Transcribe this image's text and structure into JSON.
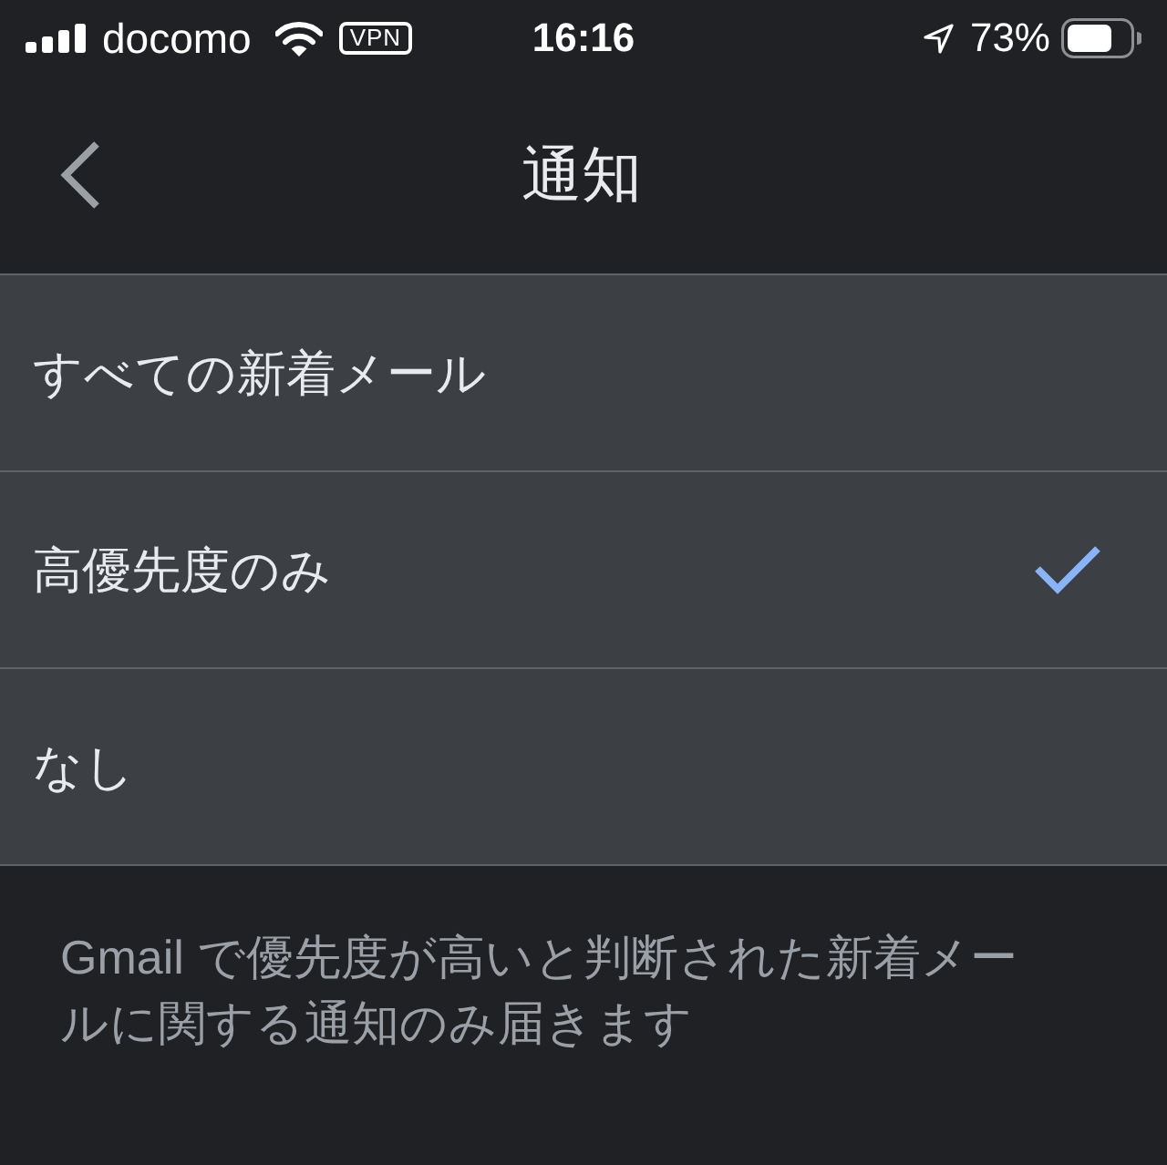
{
  "status_bar": {
    "carrier": "docomo",
    "vpn": "VPN",
    "time": "16:16",
    "battery": "73%"
  },
  "nav_bar": {
    "title": "通知"
  },
  "options": [
    {
      "label": "すべての新着メール",
      "selected": false
    },
    {
      "label": "高優先度のみ",
      "selected": true
    },
    {
      "label": "なし",
      "selected": false
    }
  ],
  "footer": {
    "text": "Gmail で優先度が高いと判断された新着メールに関する通知のみ届きます"
  }
}
